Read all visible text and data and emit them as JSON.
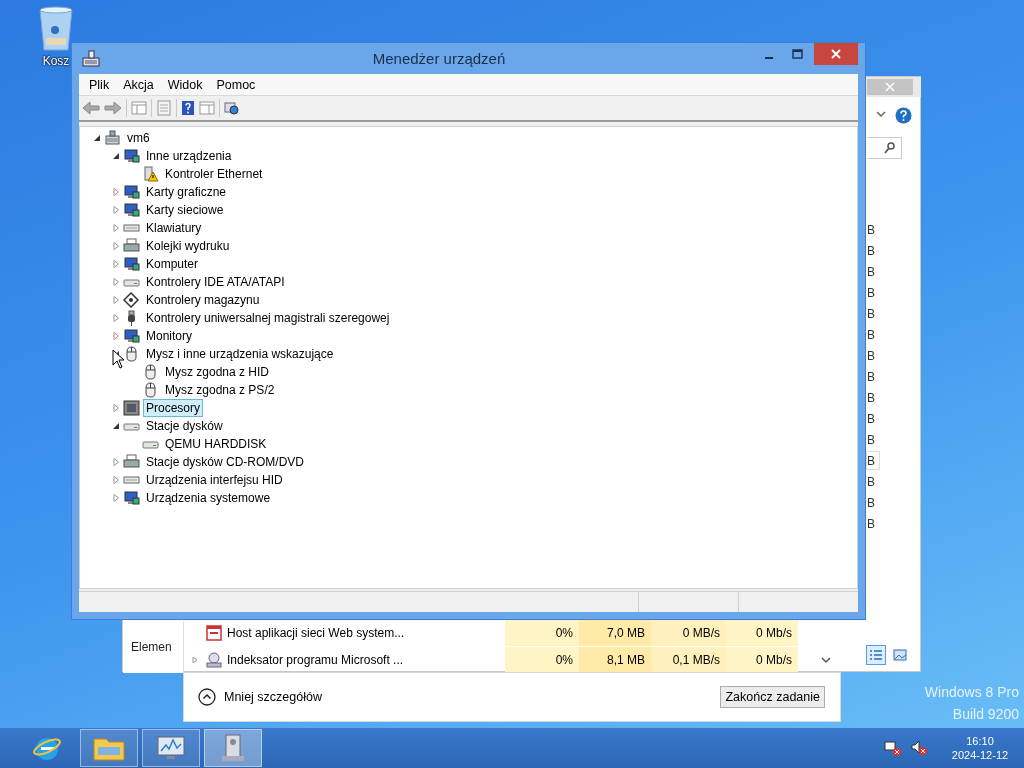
{
  "desktop": {
    "icons": [
      {
        "label": "Kosz"
      }
    ],
    "edition_lines": [
      "Windows 8 Pro",
      "Build 9200"
    ]
  },
  "task_manager": {
    "size_cells": [
      {
        "text": "B",
        "hovered": false
      },
      {
        "text": "B",
        "hovered": false
      },
      {
        "text": "B",
        "hovered": false
      },
      {
        "text": "B",
        "hovered": false
      },
      {
        "text": "B",
        "hovered": false
      },
      {
        "text": "B",
        "hovered": false
      },
      {
        "text": "B",
        "hovered": false
      },
      {
        "text": "B",
        "hovered": false
      },
      {
        "text": "B",
        "hovered": false
      },
      {
        "text": "B",
        "hovered": false
      },
      {
        "text": "B",
        "hovered": false
      },
      {
        "text": "B",
        "hovered": true
      },
      {
        "text": "B",
        "hovered": false
      },
      {
        "text": "B",
        "hovered": false
      },
      {
        "text": "B",
        "hovered": false
      }
    ],
    "rows": [
      {
        "name": "Host aplikacji sieci Web system...",
        "expandable": false,
        "cpu": "0%",
        "memory": "7,0 MB",
        "disk": "0 MB/s",
        "network": "0 Mb/s"
      },
      {
        "name": "Indeksator programu Microsoft ...",
        "expandable": true,
        "cpu": "0%",
        "memory": "8,1 MB",
        "disk": "0,1 MB/s",
        "network": "0 Mb/s"
      }
    ],
    "side_label": "Elemen",
    "views": [
      {
        "selected": true
      },
      {
        "selected": false
      }
    ],
    "details_toggle": "Mniej szczegółów",
    "end_task": "Zakończ zadanie"
  },
  "device_manager": {
    "title": "Menedżer urządzeń",
    "menu": [
      "Plik",
      "Akcja",
      "Widok",
      "Pomoc"
    ],
    "tree": {
      "label": "vm6",
      "kind": "computer",
      "expanded": true,
      "selected": false,
      "children": [
        {
          "label": "Inne urządzenia",
          "kind": "category",
          "expanded": true,
          "selected": false,
          "children": [
            {
              "label": "Kontroler Ethernet",
              "kind": "warning",
              "selected": false
            }
          ]
        },
        {
          "label": "Karty graficzne",
          "kind": "category",
          "expanded": false,
          "selected": false
        },
        {
          "label": "Karty sieciowe",
          "kind": "category",
          "expanded": false,
          "selected": false
        },
        {
          "label": "Klawiatury",
          "kind": "keyboard",
          "expanded": false,
          "selected": false
        },
        {
          "label": "Kolejki wydruku",
          "kind": "printer",
          "expanded": false,
          "selected": false
        },
        {
          "label": "Komputer",
          "kind": "category",
          "expanded": false,
          "selected": false
        },
        {
          "label": "Kontrolery IDE ATA/ATAPI",
          "kind": "drive",
          "expanded": false,
          "selected": false
        },
        {
          "label": "Kontrolery magazynu",
          "kind": "storage",
          "expanded": false,
          "selected": false
        },
        {
          "label": "Kontrolery uniwersalnej magistrali szeregowej",
          "kind": "usb",
          "expanded": false,
          "selected": false
        },
        {
          "label": "Monitory",
          "kind": "category",
          "expanded": false,
          "selected": false
        },
        {
          "label": "Mysz i inne urządzenia wskazujące",
          "kind": "mouse",
          "expanded": true,
          "selected": false,
          "children": [
            {
              "label": "Mysz zgodna z HID",
              "kind": "mouse",
              "selected": false
            },
            {
              "label": "Mysz zgodna z PS/2",
              "kind": "mouse",
              "selected": false
            }
          ]
        },
        {
          "label": "Procesory",
          "kind": "chip",
          "expanded": false,
          "selected": true
        },
        {
          "label": "Stacje dysków",
          "kind": "drive",
          "expanded": true,
          "selected": false,
          "children": [
            {
              "label": "QEMU HARDDISK",
              "kind": "drive",
              "selected": false
            }
          ]
        },
        {
          "label": "Stacje dysków CD-ROM/DVD",
          "kind": "printer",
          "expanded": false,
          "selected": false
        },
        {
          "label": "Urządzenia interfejsu HID",
          "kind": "keyboard",
          "expanded": false,
          "selected": false
        },
        {
          "label": "Urządzenia systemowe",
          "kind": "category",
          "expanded": false,
          "selected": false
        }
      ]
    }
  },
  "taskbar": {
    "apps": [
      {
        "kind": "browser",
        "running": false,
        "selected": false
      },
      {
        "kind": "folder",
        "running": true,
        "selected": false
      },
      {
        "kind": "monitor",
        "running": true,
        "selected": false
      },
      {
        "kind": "tower",
        "running": true,
        "selected": true
      }
    ],
    "clock": {
      "time": "16:10",
      "date": "2024-12-12"
    }
  }
}
